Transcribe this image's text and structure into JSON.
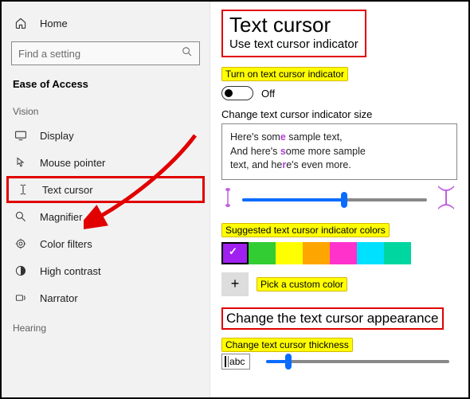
{
  "sidebar": {
    "home": "Home",
    "search_placeholder": "Find a setting",
    "category": "Ease of Access",
    "group_vision": "Vision",
    "items": {
      "display": "Display",
      "mouse": "Mouse pointer",
      "text_cursor": "Text cursor",
      "magnifier": "Magnifier",
      "color_filters": "Color filters",
      "high_contrast": "High contrast",
      "narrator": "Narrator"
    },
    "group_hearing": "Hearing"
  },
  "content": {
    "title": "Text cursor",
    "subtitle_prefix": "Use text cursor indicator",
    "toggle_heading": "Turn on text cursor indicator",
    "toggle_state": "Off",
    "size_label": "Change text cursor indicator size",
    "preview_line1_a": "Here's som",
    "preview_line1_b": " sample text,",
    "preview_line2_a": "And here's ",
    "preview_line2_b": "ome more sample",
    "preview_line3_a": "text, and he",
    "preview_line3_b": "e's even more.",
    "colors_heading": "Suggested text cursor indicator colors",
    "swatches": [
      "#a020f0",
      "#32cd32",
      "#ffff00",
      "#ffa500",
      "#ff33cc",
      "#00e0ff",
      "#00d6a0"
    ],
    "pick_custom": "Pick a custom color",
    "appearance_heading": "Change the text cursor appearance",
    "thickness_heading": "Change text cursor thickness",
    "thickness_sample": "bc"
  }
}
